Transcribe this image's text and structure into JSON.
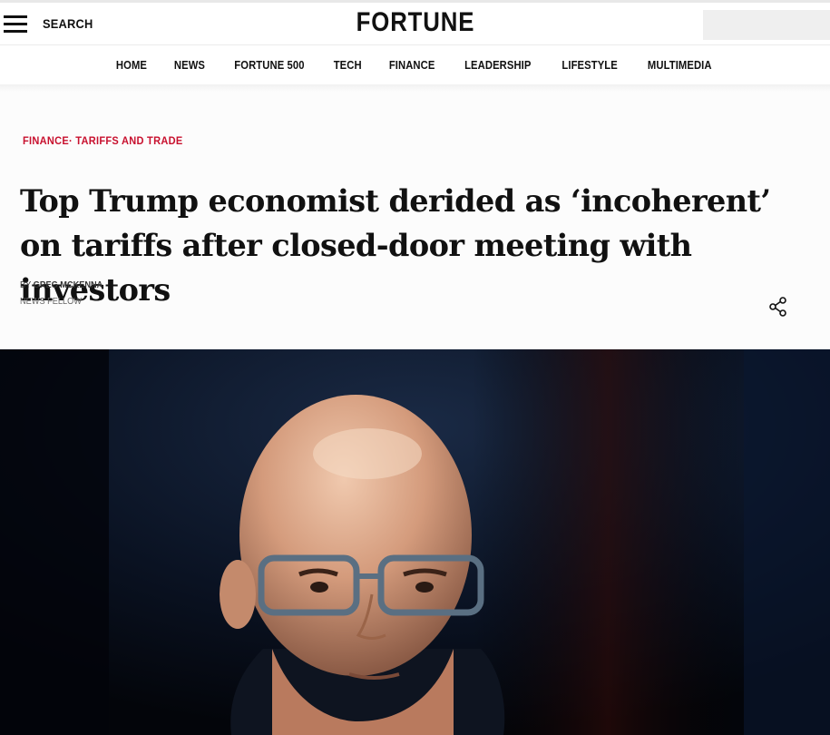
{
  "header": {
    "search_label": "SEARCH",
    "logo": "FORTUNE",
    "menu_icon": "hamburger-menu-icon"
  },
  "nav": {
    "items": [
      "HOME",
      "NEWS",
      "FORTUNE 500",
      "TECH",
      "FINANCE",
      "LEADERSHIP",
      "LIFESTYLE",
      "MULTIMEDIA"
    ]
  },
  "article": {
    "category_primary": "FINANCE",
    "category_separator": "· ",
    "category_secondary": "TARIFFS AND TRADE",
    "headline": "Top Trump economist derided as ‘incoherent’ on tariffs after closed-door meeting with investors",
    "byline_prefix": "BY ",
    "author": "GREG MCKENNA",
    "author_role": "NEWS FELLOW",
    "share_icon": "share-icon"
  },
  "colors": {
    "accent": "#c8102e",
    "text": "#111111",
    "photo_background": "#05070c"
  }
}
